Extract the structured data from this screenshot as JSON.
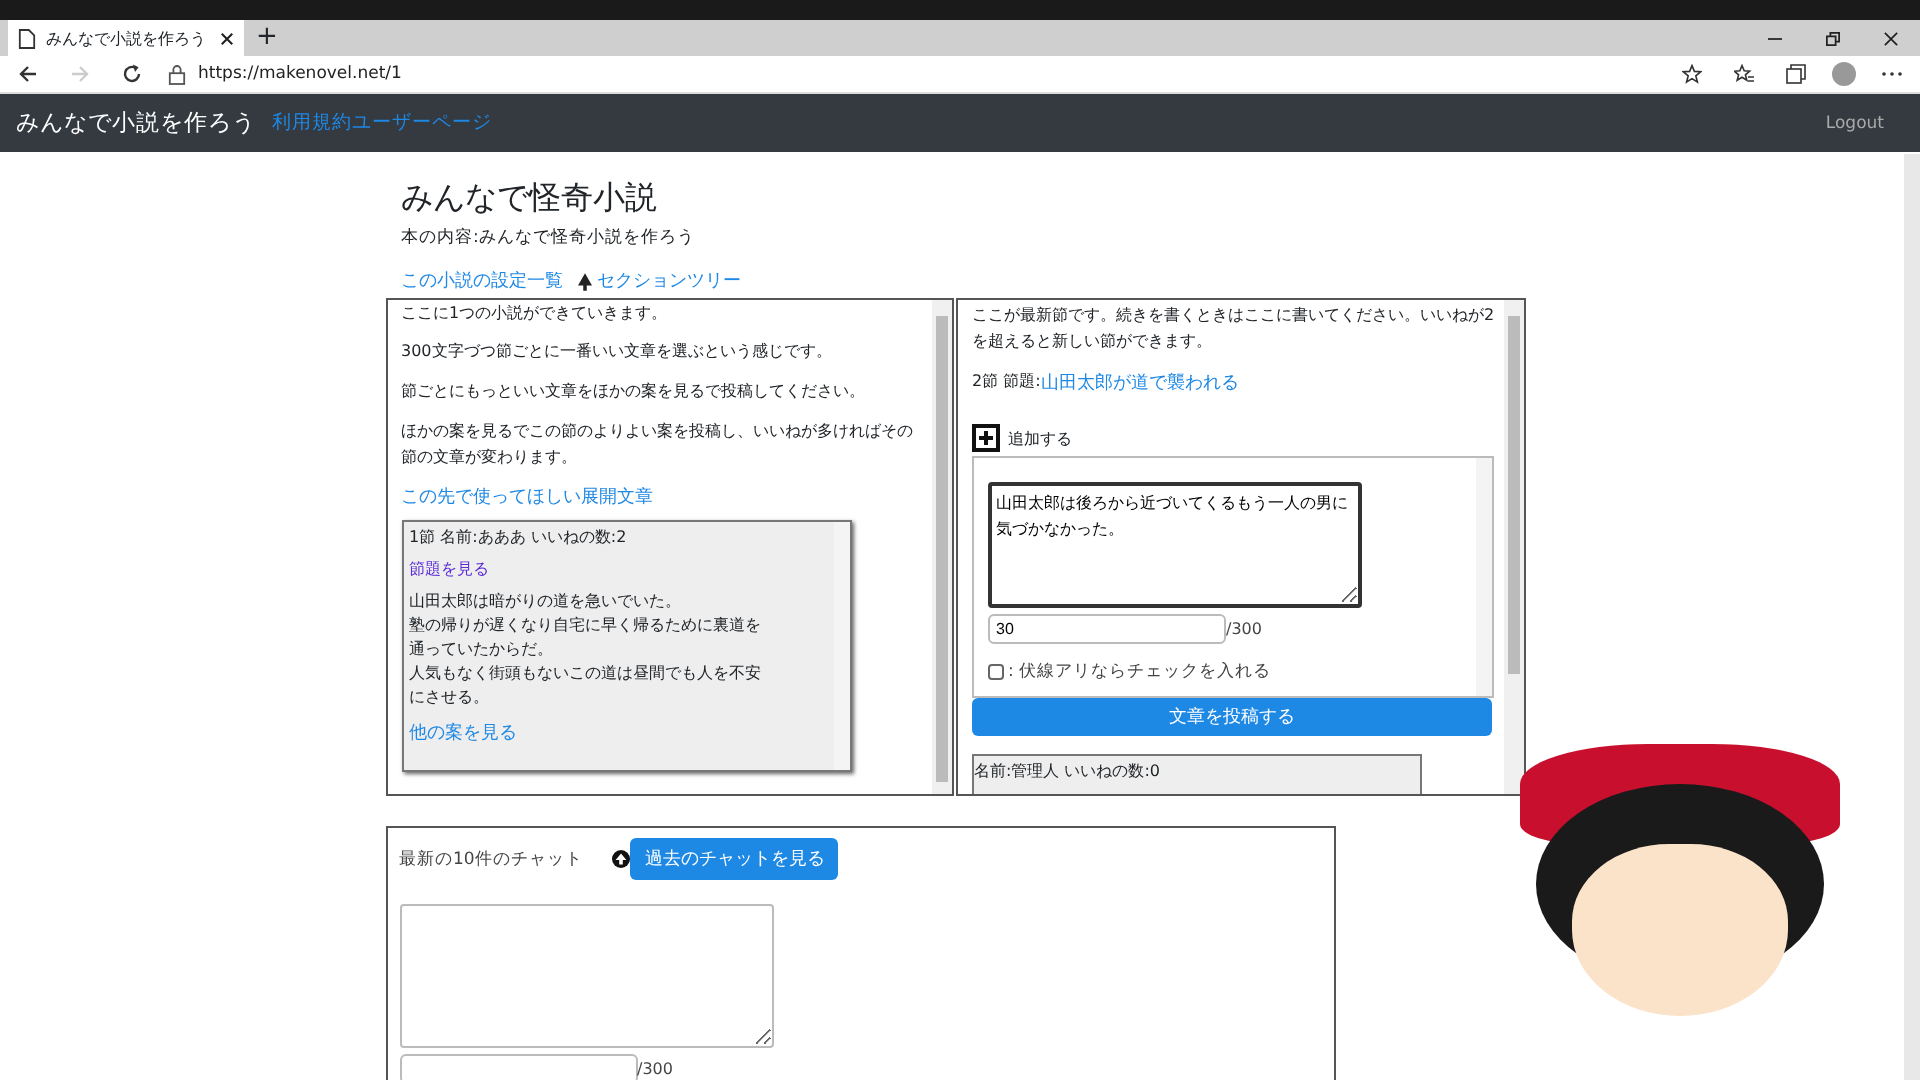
{
  "browser": {
    "tab_title": "みんなで小説を作ろう",
    "new_tab": "+",
    "url": "https://makenovel.net/1"
  },
  "navbar": {
    "brand": "みんなで小説を作ろう",
    "links": [
      "利用規約",
      "ユーザーページ"
    ],
    "logout": "Logout"
  },
  "novel": {
    "title": "みんなで怪奇小説",
    "description": "本の内容:みんなで怪奇小説を作ろう",
    "links": [
      "この小説の設定一覧",
      "セクションツリー"
    ]
  },
  "left_panel": {
    "paragraphs": [
      "ここに1つの小説ができていきます。",
      "300文字づつ節ごとに一番いい文章を選ぶという感じです。",
      "節ごとにもっといい文章をほかの案を見るで投稿してください。",
      "ほかの案を見るでこの節のよりよい案を投稿し、いいねが多ければその節の文章が変わります。"
    ],
    "link": "この先で使ってほしい展開文章",
    "section": {
      "header": "1節 名前:あああ いいねの数:2",
      "title_link": "節題を見る",
      "lines": [
        "山田太郎は暗がりの道を急いでいた。",
        "塾の帰りが遅くなり自宅に早く帰るために裏道を",
        "通っていたからだ。",
        "人気もなく街頭もないこの道は昼間でも人を不安",
        "にさせる。"
      ],
      "other_link": "他の案を見る"
    }
  },
  "right_panel": {
    "notice": "ここが最新節です。続きを書くときはここに書いてください。いいねが2を超えると新しい節ができます。",
    "section_label": "2節 節題:",
    "section_title": "山田太郎が道で襲われる",
    "add_label": "追加する",
    "draft": "山田太郎は後ろから近づいてくるもう一人の男に気づかなかった。",
    "count": "30",
    "limit": "/300",
    "foreshadow": {
      "label": ": 伏線アリならチェックを入れる",
      "checked": false
    },
    "submit": "文章を投稿する",
    "entry_header": "名前:管理人 いいねの数:0"
  },
  "chat": {
    "label": "最新の10件のチャット",
    "button": "過去のチャットを見る",
    "limit": "/300"
  }
}
